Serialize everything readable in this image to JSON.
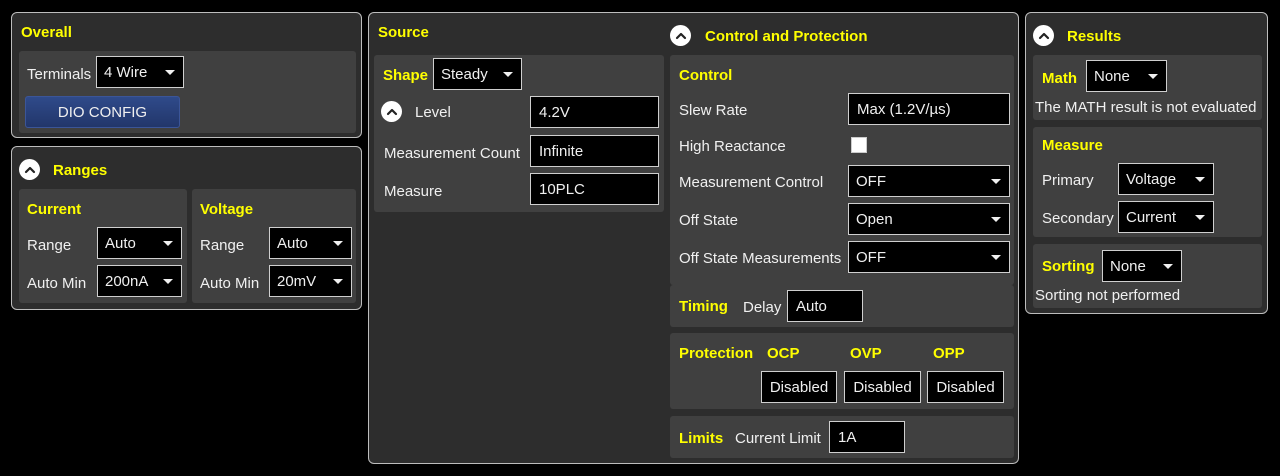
{
  "overall": {
    "title": "Overall",
    "terminals_label": "Terminals",
    "terminals_value": "4 Wire",
    "dio_button": "DIO CONFIG"
  },
  "ranges": {
    "title": "Ranges",
    "current": {
      "title": "Current",
      "range_label": "Range",
      "range_value": "Auto",
      "automin_label": "Auto Min",
      "automin_value": "200nA"
    },
    "voltage": {
      "title": "Voltage",
      "range_label": "Range",
      "range_value": "Auto",
      "automin_label": "Auto Min",
      "automin_value": "20mV"
    }
  },
  "source": {
    "title": "Source",
    "shape_label": "Shape",
    "shape_value": "Steady",
    "level_label": "Level",
    "level_value": "4.2V",
    "count_label": "Measurement Count",
    "count_value": "Infinite",
    "measure_label": "Measure",
    "measure_value": "10PLC"
  },
  "control_protection": {
    "title": "Control and Protection",
    "control": {
      "title": "Control",
      "slew_label": "Slew Rate",
      "slew_value": "Max (1.2V/µs)",
      "high_reactance_label": "High Reactance",
      "meas_control_label": "Measurement Control",
      "meas_control_value": "OFF",
      "off_state_label": "Off State",
      "off_state_value": "Open",
      "off_state_meas_label": "Off State Measurements",
      "off_state_meas_value": "OFF"
    },
    "timing": {
      "title": "Timing",
      "delay_label": "Delay",
      "delay_value": "Auto"
    },
    "protection": {
      "title": "Protection",
      "ocp_label": "OCP",
      "ocp_value": "Disabled",
      "ovp_label": "OVP",
      "ovp_value": "Disabled",
      "opp_label": "OPP",
      "opp_value": "Disabled"
    },
    "limits": {
      "title": "Limits",
      "current_limit_label": "Current Limit",
      "current_limit_value": "1A"
    }
  },
  "results": {
    "title": "Results",
    "math": {
      "title": "Math",
      "value": "None",
      "note": "The MATH result is not evaluated"
    },
    "measure": {
      "title": "Measure",
      "primary_label": "Primary",
      "primary_value": "Voltage",
      "secondary_label": "Secondary",
      "secondary_value": "Current"
    },
    "sorting": {
      "title": "Sorting",
      "value": "None",
      "note": "Sorting not performed"
    }
  },
  "colors": {
    "accent_title": "#ffff00",
    "panel_bg": "#2d2d2d",
    "subpanel_bg": "#404040",
    "dio_button": "#2a4080"
  },
  "icons": {
    "collapse": "chevron-up-circle-icon",
    "dropdown": "caret-down-icon"
  }
}
